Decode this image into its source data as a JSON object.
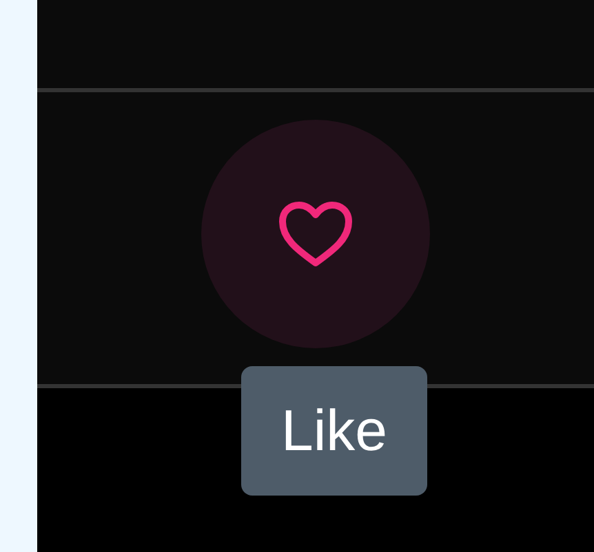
{
  "like_button": {
    "liked": false,
    "tooltip": "Like"
  }
}
